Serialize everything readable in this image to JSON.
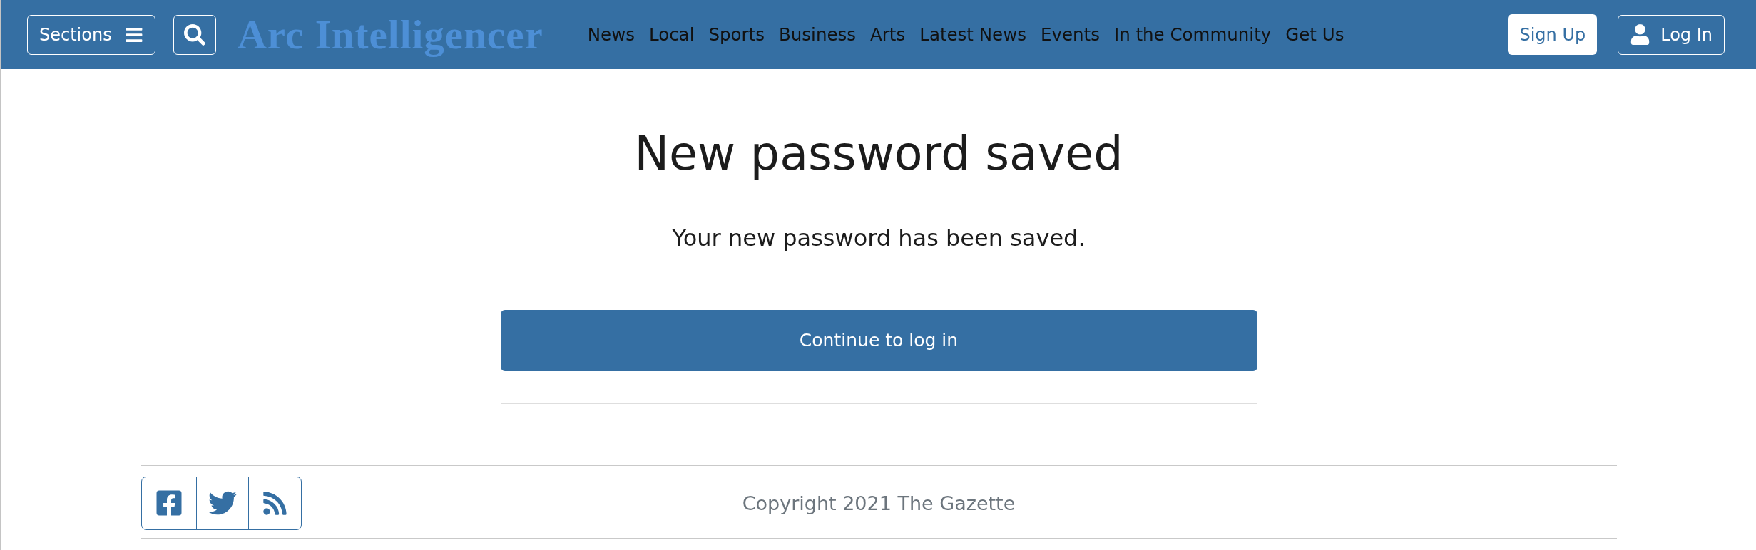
{
  "header": {
    "sections_button": {
      "label": "Sections"
    },
    "logo": "Arc Intelligencer",
    "nav": [
      {
        "label": "News"
      },
      {
        "label": "Local"
      },
      {
        "label": "Sports"
      },
      {
        "label": "Business"
      },
      {
        "label": "Arts"
      },
      {
        "label": "Latest News"
      },
      {
        "label": "Events"
      },
      {
        "label": "In the Community"
      },
      {
        "label": "Get Us"
      }
    ],
    "sign_up": {
      "label": "Sign Up"
    },
    "log_in": {
      "label": "Log In"
    }
  },
  "main": {
    "title": "New password saved",
    "message": "Your new password has been saved.",
    "button": {
      "label": "Continue to log in"
    }
  },
  "footer": {
    "social_links": [
      {
        "kind": "facebook"
      },
      {
        "kind": "twitter"
      },
      {
        "kind": "rss"
      }
    ],
    "copyright": "Copyright 2021 The Gazette"
  }
}
